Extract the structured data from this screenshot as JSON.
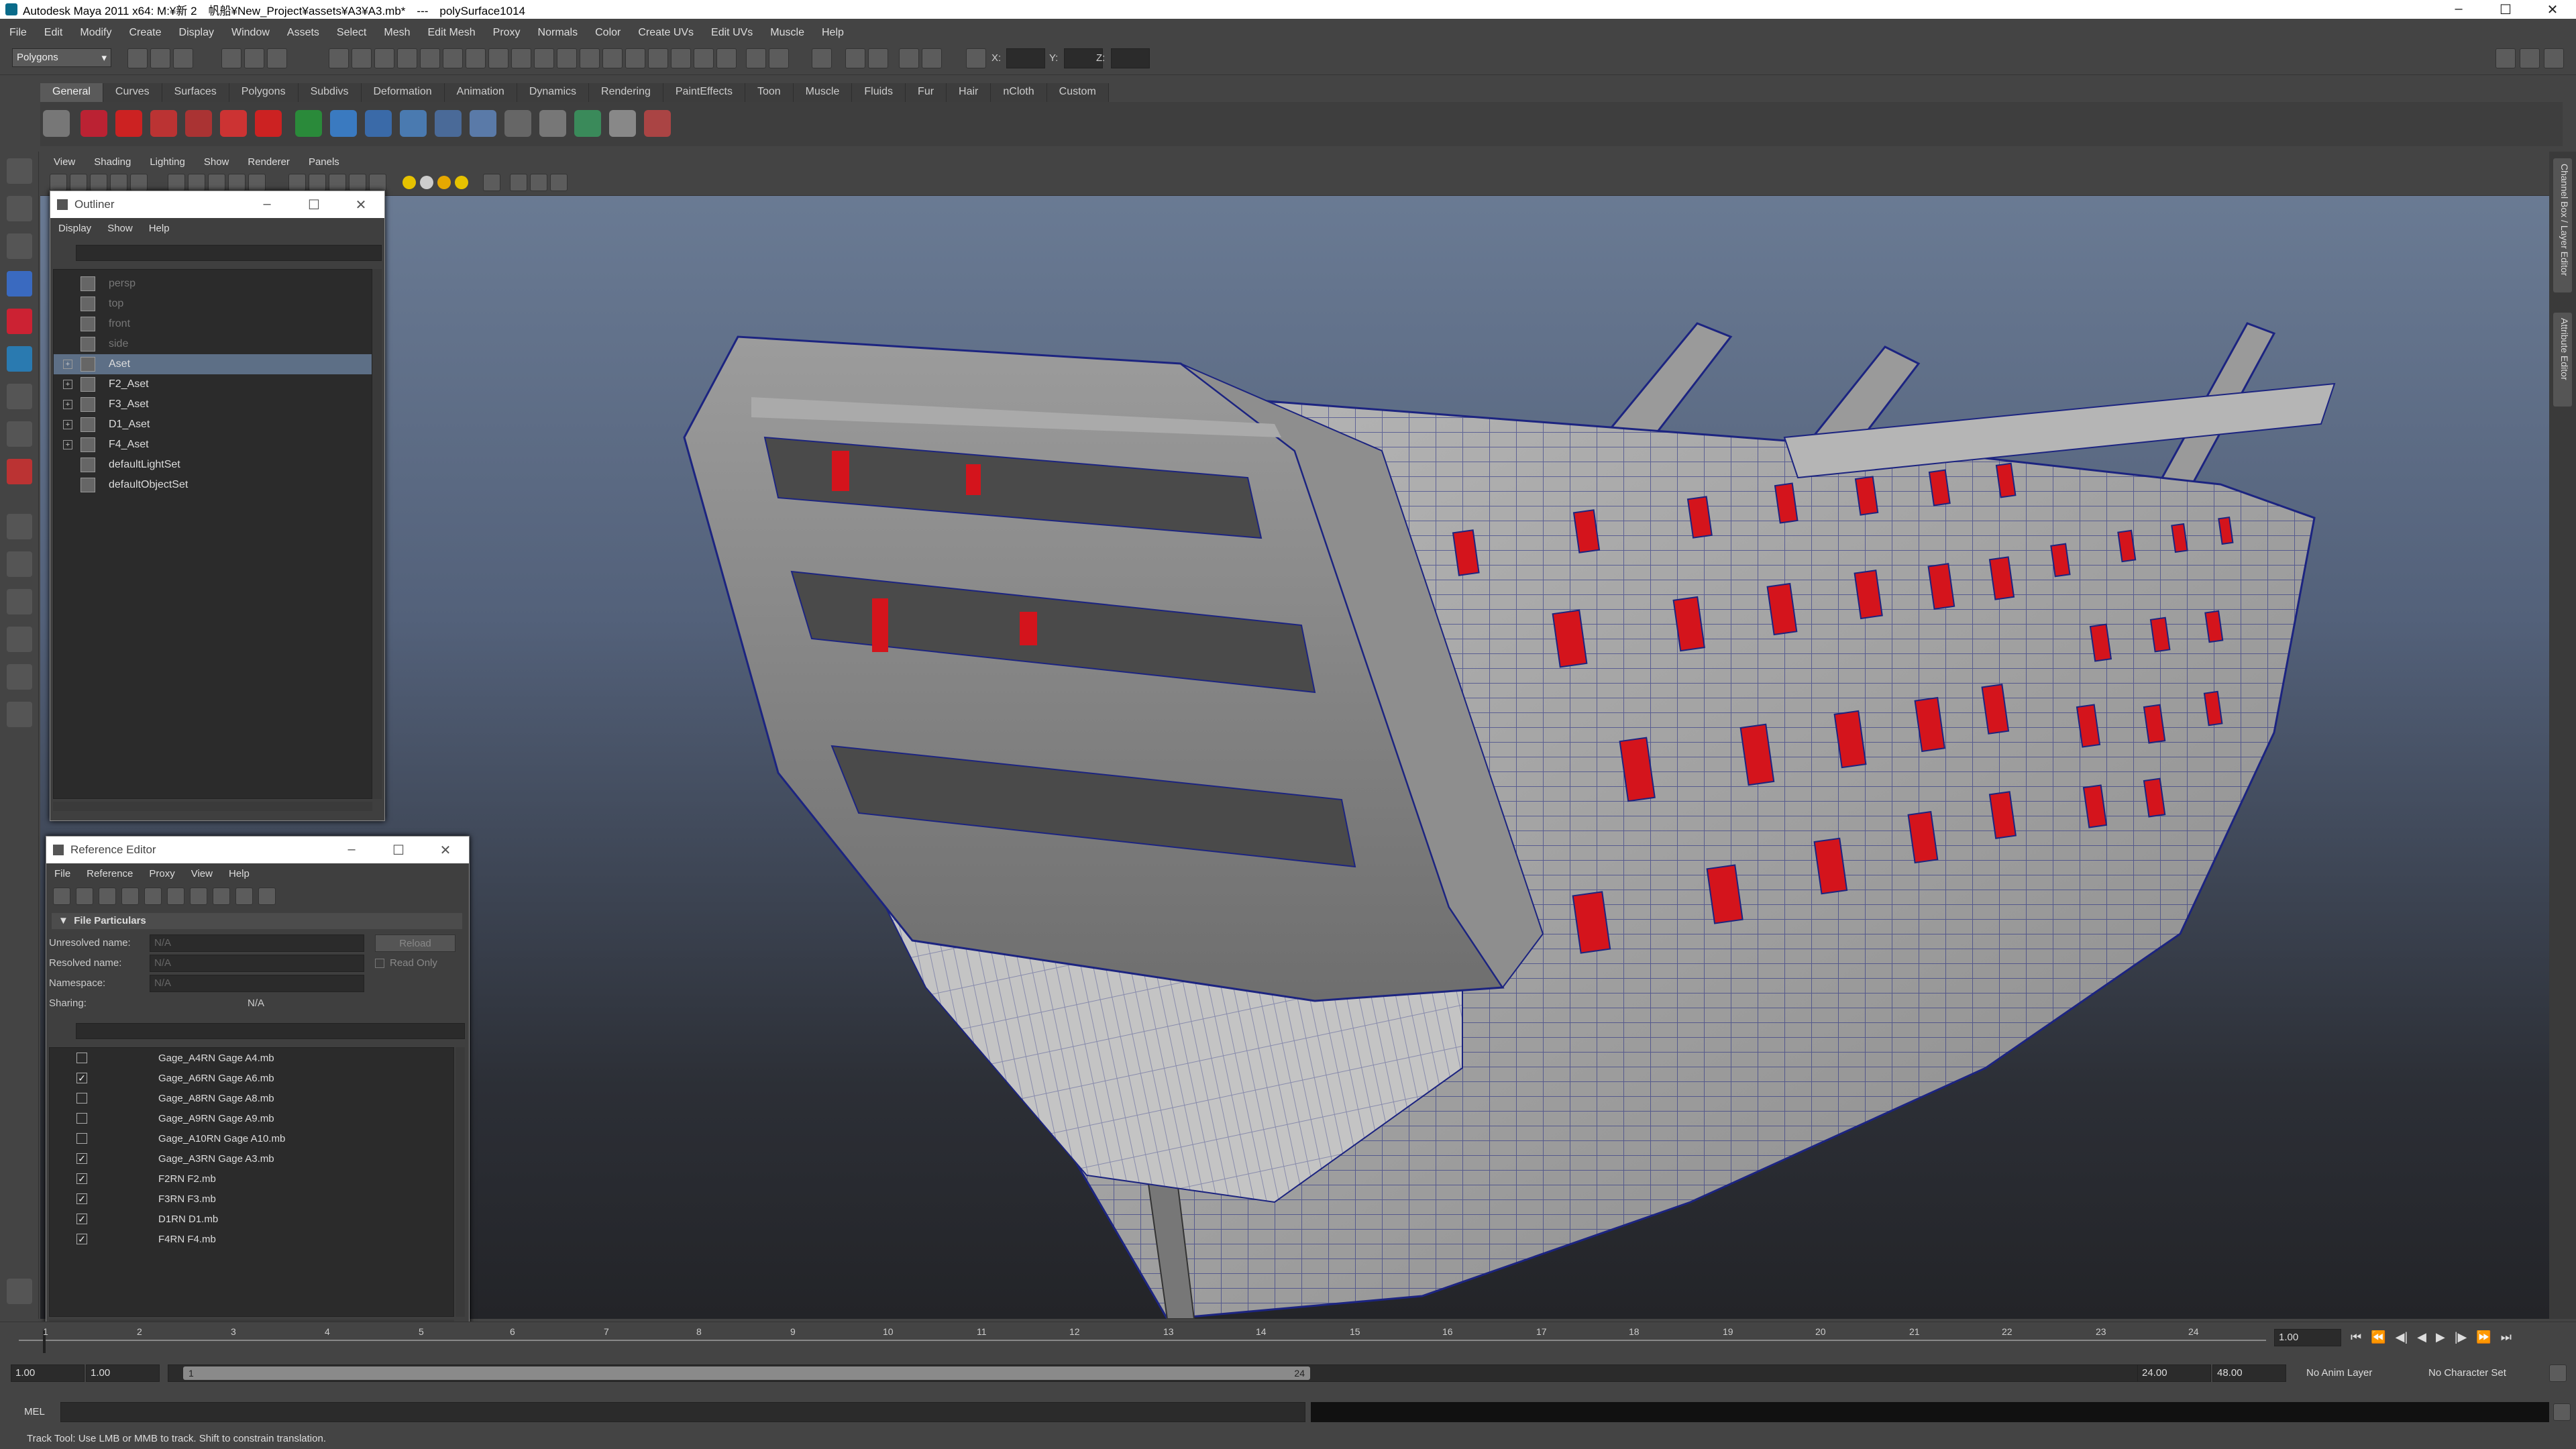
{
  "titlebar": {
    "title": "Autodesk Maya 2011 x64: M:¥新 2　帆船¥New_Project¥assets¥A3¥A3.mb*　---　polySurface1014",
    "minimize": "–",
    "maximize": "☐",
    "close": "✕"
  },
  "menubar": {
    "items": [
      "File",
      "Edit",
      "Modify",
      "Create",
      "Display",
      "Window",
      "Assets",
      "Select",
      "Mesh",
      "Edit Mesh",
      "Proxy",
      "Normals",
      "Color",
      "Create UVs",
      "Edit UVs",
      "Muscle",
      "Help"
    ]
  },
  "status_line": {
    "menu_set": "Polygons",
    "x_label": "X:",
    "y_label": "Y:",
    "z_label": "Z:"
  },
  "shelf": {
    "tabs": [
      "General",
      "Curves",
      "Surfaces",
      "Polygons",
      "Subdivs",
      "Deformation",
      "Animation",
      "Dynamics",
      "Rendering",
      "PaintEffects",
      "Toon",
      "Muscle",
      "Fluids",
      "Fur",
      "Hair",
      "nCloth",
      "Custom"
    ],
    "active_tab": "General"
  },
  "viewport": {
    "menu": [
      "View",
      "Shading",
      "Lighting",
      "Show",
      "Renderer",
      "Panels"
    ]
  },
  "right_tabs": {
    "channel_box": "Channel Box / Layer Editor",
    "attribute_editor": "Attribute Editor"
  },
  "outliner": {
    "title": "Outliner",
    "menu": [
      "Display",
      "Show",
      "Help"
    ],
    "cameras": [
      "persp",
      "top",
      "front",
      "side"
    ],
    "nodes": [
      "Aset",
      "F2_Aset",
      "F3_Aset",
      "D1_Aset",
      "F4_Aset"
    ],
    "sets": [
      "defaultLightSet",
      "defaultObjectSet"
    ],
    "selected": "Aset"
  },
  "reference_editor": {
    "title": "Reference Editor",
    "menu": [
      "File",
      "Reference",
      "Proxy",
      "View",
      "Help"
    ],
    "section": "File Particulars",
    "unresolved_label": "Unresolved name:",
    "unresolved_value": "N/A",
    "resolved_label": "Resolved name:",
    "resolved_value": "N/A",
    "namespace_label": "Namespace:",
    "namespace_value": "N/A",
    "sharing_label": "Sharing:",
    "sharing_value": "N/A",
    "reload_button": "Reload",
    "read_only_label": "Read Only",
    "files": [
      {
        "name": "Gage_A4RN Gage A4.mb",
        "checked": false
      },
      {
        "name": "Gage_A6RN Gage A6.mb",
        "checked": true
      },
      {
        "name": "Gage_A8RN Gage A8.mb",
        "checked": false
      },
      {
        "name": "Gage_A9RN Gage A9.mb",
        "checked": false
      },
      {
        "name": "Gage_A10RN Gage A10.mb",
        "checked": false
      },
      {
        "name": "Gage_A3RN Gage A3.mb",
        "checked": true
      },
      {
        "name": "F2RN F2.mb",
        "checked": true
      },
      {
        "name": "F3RN F3.mb",
        "checked": true
      },
      {
        "name": "D1RN D1.mb",
        "checked": true
      },
      {
        "name": "F4RN F4.mb",
        "checked": true
      }
    ]
  },
  "time_slider": {
    "ticks": [
      "1",
      "2",
      "3",
      "4",
      "5",
      "6",
      "7",
      "8",
      "9",
      "10",
      "11",
      "12",
      "13",
      "14",
      "15",
      "16",
      "17",
      "18",
      "19",
      "20",
      "21",
      "22",
      "23",
      "24"
    ],
    "current_time": "1.00"
  },
  "range_slider": {
    "start": "1.00",
    "playback_start": "1.00",
    "range_start_label": "1",
    "range_end_label": "24",
    "playback_end": "24.00",
    "end": "48.00",
    "anim_layer": "No Anim Layer",
    "character_set": "No Character Set"
  },
  "command_line": {
    "label": "MEL"
  },
  "help_line": {
    "text": "Track Tool: Use LMB or MMB to track. Shift to constrain translation."
  },
  "colors": {
    "hull": "#a8a8a8",
    "wire": "#1c2480",
    "gunports": "#d4141c",
    "selection": "#5d6f86"
  }
}
